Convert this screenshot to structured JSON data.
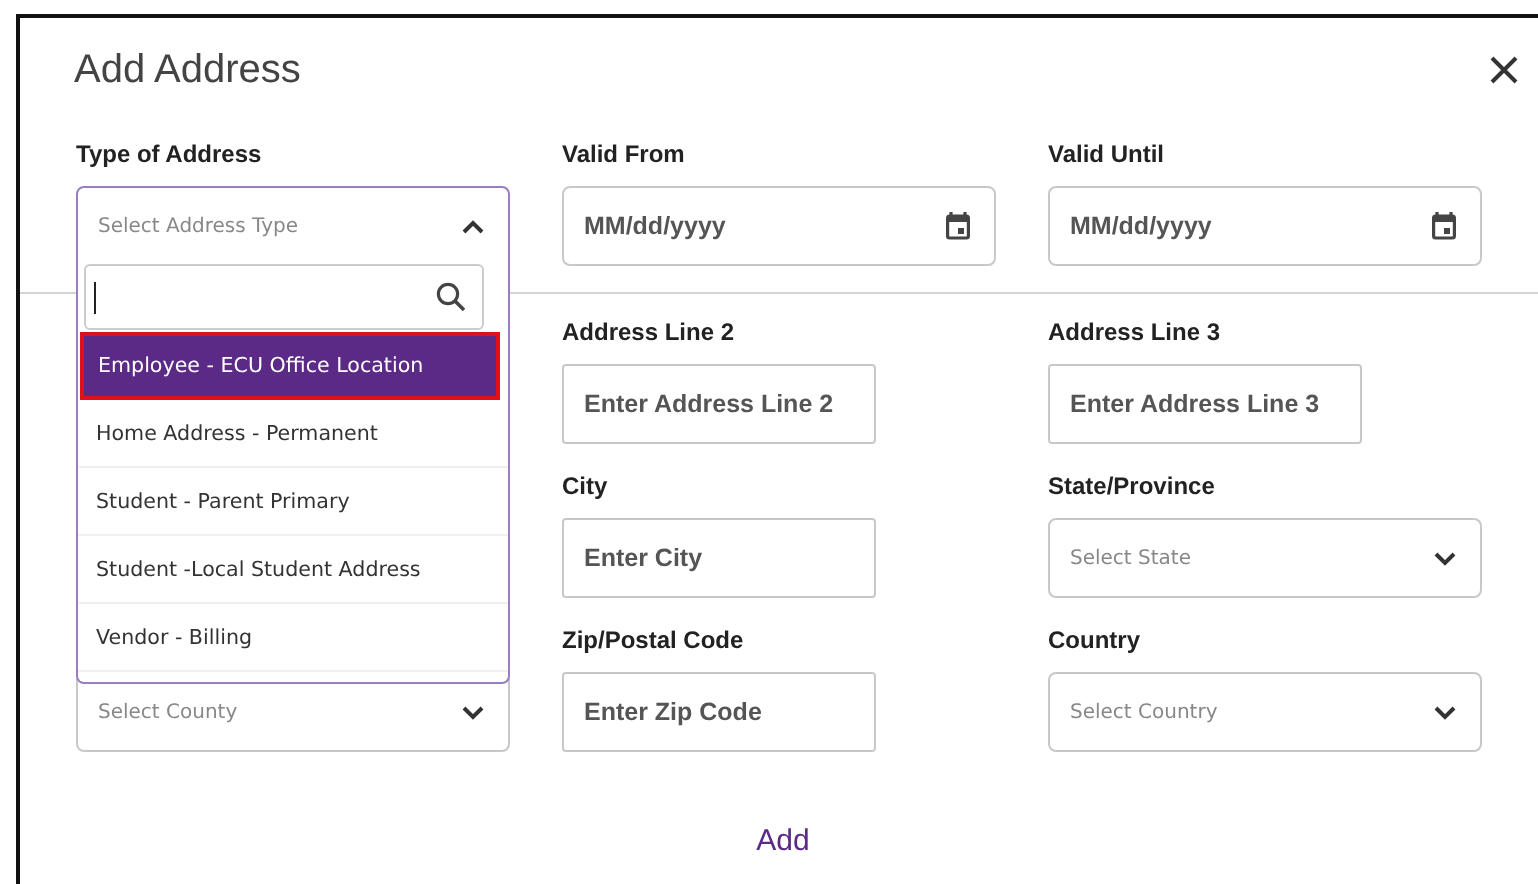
{
  "dialog": {
    "title": "Add Address"
  },
  "top_fields": [
    {
      "kind": "select",
      "label": "Type of Address",
      "placeholder": "Select Address Type",
      "expanded": true,
      "options": [
        {
          "label": "Employee - ECU Office Location",
          "selected": true
        },
        {
          "label": "Home Address - Permanent",
          "selected": false
        },
        {
          "label": "Student - Parent Primary",
          "selected": false
        },
        {
          "label": "Student -Local Student Address",
          "selected": false
        },
        {
          "label": "Vendor - Billing",
          "selected": false
        }
      ]
    },
    {
      "kind": "date",
      "label": "Valid From",
      "placeholder": "MM/dd/yyyy"
    },
    {
      "kind": "date",
      "label": "Valid Until",
      "placeholder": "MM/dd/yyyy"
    }
  ],
  "fields": [
    {
      "kind": "text",
      "label": "Address Line 2",
      "placeholder": "Enter Address Line 2"
    },
    {
      "kind": "text",
      "label": "Address Line 3",
      "placeholder": "Enter Address Line 3"
    },
    {
      "kind": "text",
      "label": "City",
      "placeholder": "Enter City"
    },
    {
      "kind": "select",
      "label": "State/Province",
      "placeholder": "Select State"
    },
    {
      "kind": "select",
      "placeholder": "Select County"
    },
    {
      "kind": "text",
      "label": "Zip/Postal Code",
      "placeholder": "Enter Zip Code"
    },
    {
      "kind": "select",
      "label": "Country",
      "placeholder": "Select Country"
    }
  ],
  "submit": {
    "label": "Add"
  }
}
